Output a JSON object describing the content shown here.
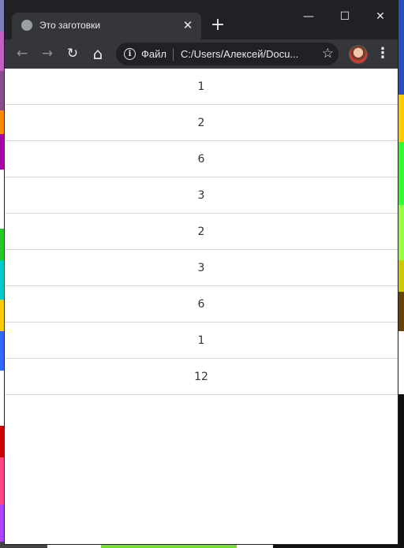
{
  "tab": {
    "title": "Это заготовки",
    "close_glyph": "✕",
    "favicon": "globe-icon"
  },
  "new_tab_glyph": "+",
  "window_controls": {
    "minimize": "—",
    "maximize": "☐",
    "close": "✕"
  },
  "toolbar": {
    "back_glyph": "←",
    "forward_glyph": "→",
    "reload_glyph": "↻",
    "home_glyph": "⌂",
    "menu_glyph": "⋮",
    "star_glyph": "☆"
  },
  "omnibox": {
    "info_glyph": "i",
    "label": "Файл",
    "url": "C:/Users/Алексей/Docu..."
  },
  "list": [
    "1",
    "2",
    "6",
    "3",
    "2",
    "3",
    "6",
    "1",
    "12"
  ],
  "colors": {
    "titlebar": "#202124",
    "toolbar": "#35363a",
    "page": "#ffffff"
  }
}
